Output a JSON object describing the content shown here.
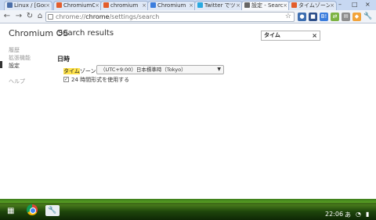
{
  "tabs": [
    {
      "label": "Linux / [Goo",
      "favicon_color": "#4a6ea9"
    },
    {
      "label": "ChromiumO",
      "favicon_color": "#e35d2c"
    },
    {
      "label": "chromium",
      "favicon_color": "#e35d2c"
    },
    {
      "label": "Chromium",
      "favicon_color": "#3b7ddd"
    },
    {
      "label": "Twitter でツイ",
      "favicon_color": "#2aa9e0"
    },
    {
      "label": "設定 - Search",
      "favicon_color": "#666666"
    },
    {
      "label": "タイムゾーン",
      "favicon_color": "#e35d2c"
    }
  ],
  "omnibox": {
    "prefix": "chrome://",
    "host": "chrome",
    "path": "/settings/search"
  },
  "settings": {
    "app_title": "Chromium OS",
    "page_title": "Search results",
    "nav": [
      {
        "label": "履歴"
      },
      {
        "label": "拡張機能"
      },
      {
        "label": "設定"
      },
      {
        "label": "ヘルプ"
      }
    ],
    "search": {
      "value": "タイム"
    },
    "section_title": "日時",
    "timezone": {
      "label_highlight": "タイム",
      "label_rest": "ゾーン:",
      "value": "（UTC+9:00）日本標準時（Tokyo）"
    },
    "checkbox": {
      "label": "24 時間形式を使用する"
    }
  },
  "taskbar": {
    "clock": "22:06",
    "ime": "あ"
  }
}
